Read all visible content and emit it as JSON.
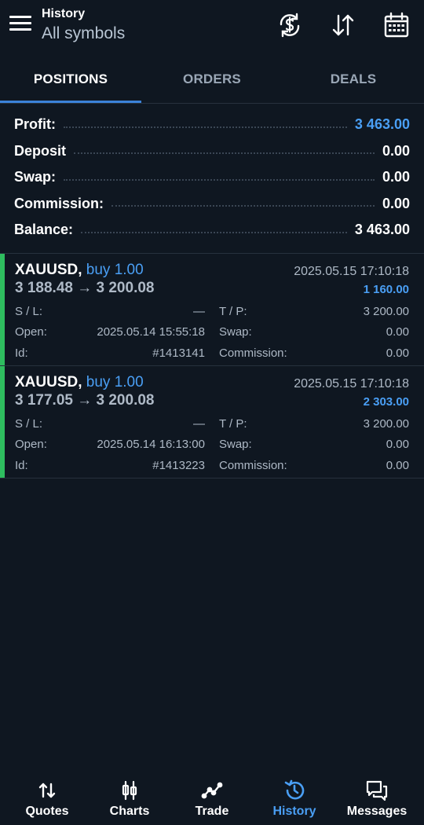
{
  "header": {
    "title": "History",
    "subtitle": "All symbols",
    "icons": [
      "menu-icon",
      "currency-sync-icon",
      "sort-arrows-icon",
      "calendar-icon"
    ]
  },
  "tabs": [
    {
      "label": "POSITIONS",
      "active": true
    },
    {
      "label": "ORDERS",
      "active": false
    },
    {
      "label": "DEALS",
      "active": false
    }
  ],
  "summary": {
    "profit": {
      "label": "Profit:",
      "value": "3 463.00"
    },
    "deposit": {
      "label": "Deposit",
      "value": "0.00"
    },
    "swap": {
      "label": "Swap:",
      "value": "0.00"
    },
    "commission": {
      "label": "Commission:",
      "value": "0.00"
    },
    "balance": {
      "label": "Balance:",
      "value": "3 463.00"
    }
  },
  "positions": [
    {
      "symbol": "XAUUSD,",
      "side": "buy 1.00",
      "prices": "3 188.48 → 3 200.08",
      "time": "2025.05.15 17:10:18",
      "profit": "1 160.00",
      "sl_label": "S / L:",
      "sl_value": "—",
      "tp_label": "T / P:",
      "tp_value": "3 200.00",
      "open_label": "Open:",
      "open_value": "2025.05.14 15:55:18",
      "swap_label": "Swap:",
      "swap_value": "0.00",
      "id_label": "Id:",
      "id_value": "#1413141",
      "commission_label": "Commission:",
      "commission_value": "0.00"
    },
    {
      "symbol": "XAUUSD,",
      "side": "buy 1.00",
      "prices": "3 177.05 → 3 200.08",
      "time": "2025.05.15 17:10:18",
      "profit": "2 303.00",
      "sl_label": "S / L:",
      "sl_value": "—",
      "tp_label": "T / P:",
      "tp_value": "3 200.00",
      "open_label": "Open:",
      "open_value": "2025.05.14 16:13:00",
      "swap_label": "Swap:",
      "swap_value": "0.00",
      "id_label": "Id:",
      "id_value": "#1413223",
      "commission_label": "Commission:",
      "commission_value": "0.00"
    }
  ],
  "bottom_nav": [
    {
      "label": "Quotes",
      "icon": "quotes-icon",
      "active": false
    },
    {
      "label": "Charts",
      "icon": "charts-icon",
      "active": false
    },
    {
      "label": "Trade",
      "icon": "trade-icon",
      "active": false
    },
    {
      "label": "History",
      "icon": "history-icon",
      "active": true
    },
    {
      "label": "Messages",
      "icon": "messages-icon",
      "active": false
    }
  ],
  "colors": {
    "background": "#0f1721",
    "accent": "#4a9ff5",
    "buy_bar": "#2ebd5f",
    "muted_text": "#aeb9c6"
  }
}
